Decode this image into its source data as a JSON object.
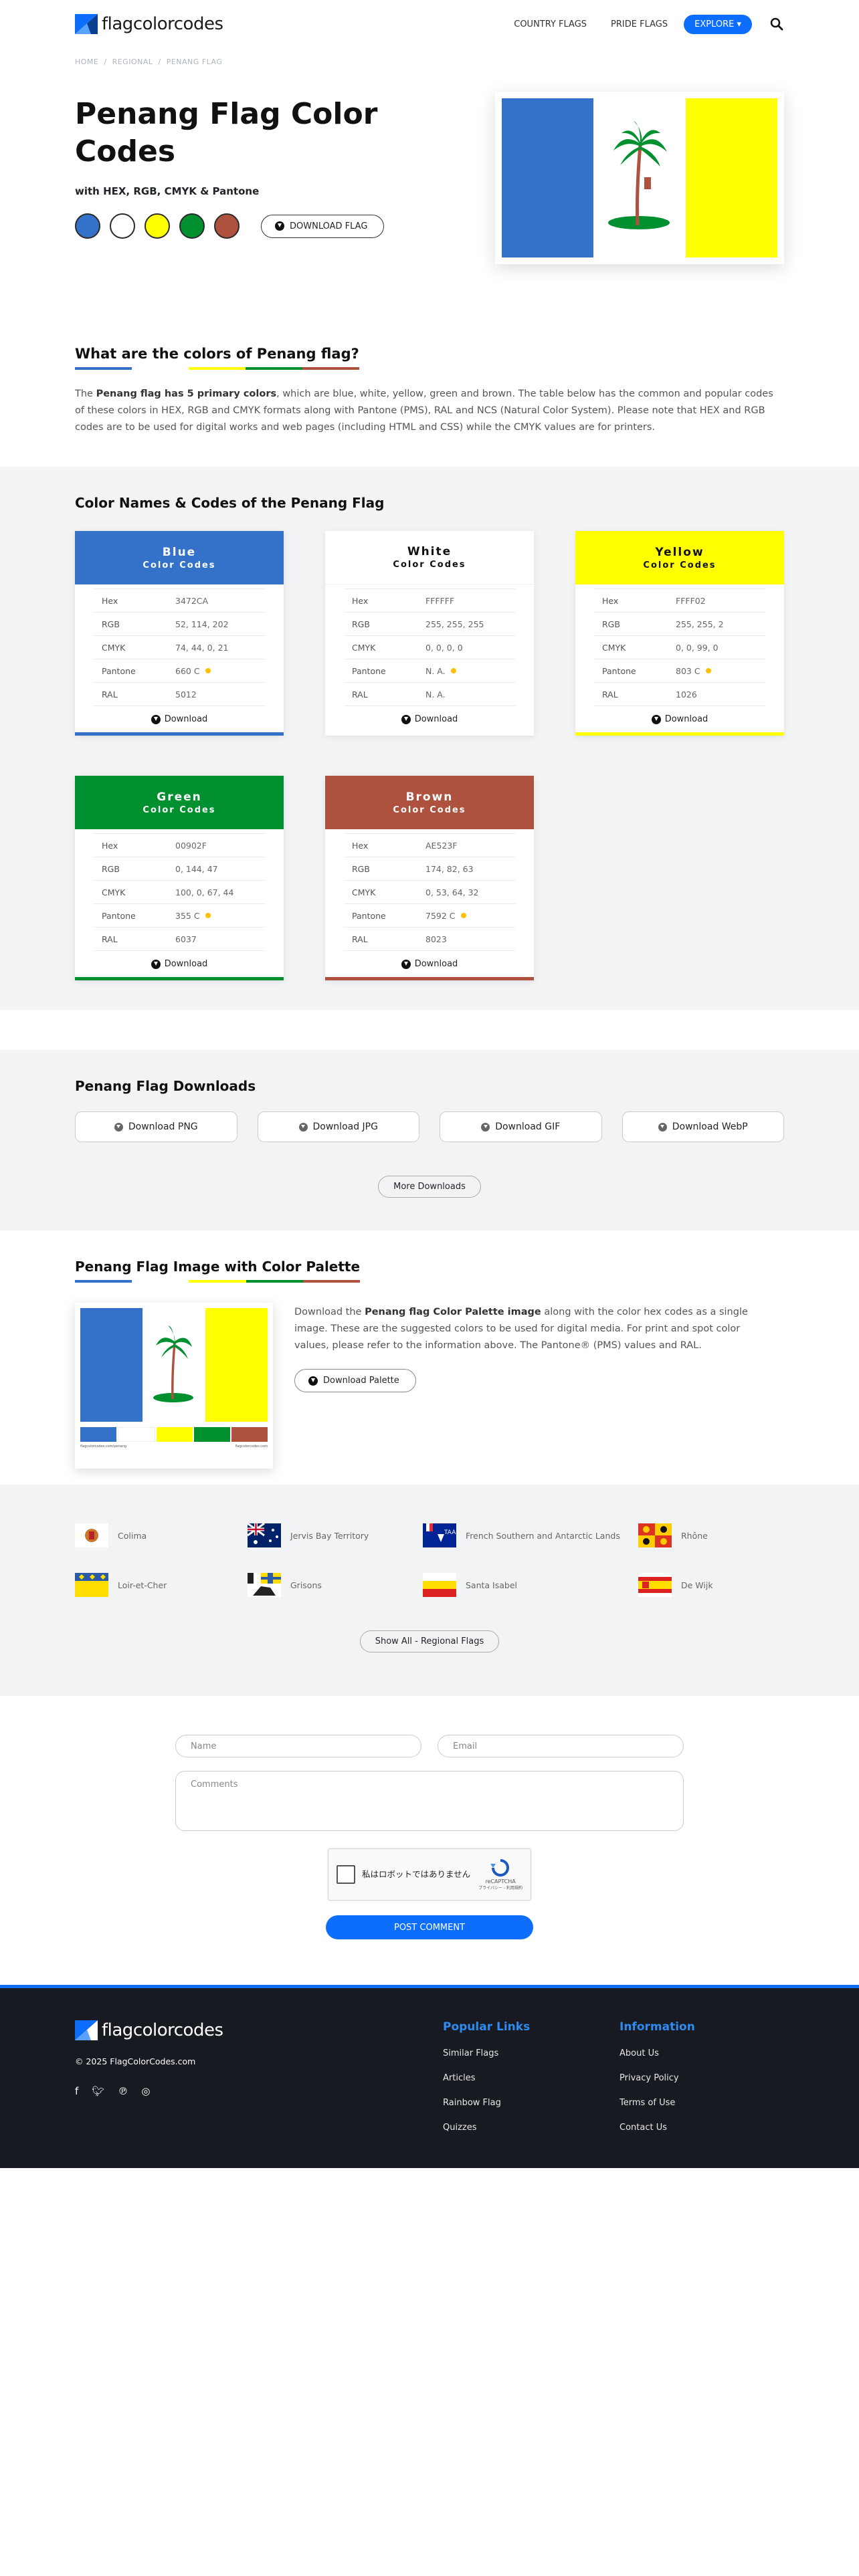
{
  "header": {
    "logo": "flagcolorcodes",
    "nav": [
      "COUNTRY FLAGS",
      "PRIDE FLAGS"
    ],
    "explore": "EXPLORE"
  },
  "breadcrumb": [
    "HOME",
    "REGIONAL",
    "PENANG FLAG"
  ],
  "hero": {
    "title_line1": "Penang Flag Color",
    "title_line2": "Codes",
    "subtitle": "with HEX, RGB, CMYK & Pantone",
    "download": "DOWNLOAD FLAG",
    "swatches": [
      "#3472CA",
      "#FFFFFF",
      "#FFFF02",
      "#00902F",
      "#AE523F"
    ]
  },
  "colors_section": {
    "title": "What are the colors of Penang flag?",
    "para_lead": "The ",
    "para_bold": "Penang flag has 5 primary colors",
    "para_rest": ", which are blue, white, yellow, green and brown. The table below has the common and popular codes of these colors in HEX, RGB and CMYK formats along with Pantone (PMS), RAL and NCS (Natural Color System). Please note that HEX and RGB codes are to be used for digital works and web pages (including HTML and CSS) while the CMYK values are for printers."
  },
  "codes_section": {
    "title": "Color Names & Codes of the Penang Flag",
    "sub": "Color Codes",
    "labels": [
      "Hex",
      "RGB",
      "CMYK",
      "Pantone",
      "RAL"
    ],
    "download": "Download",
    "cards": [
      {
        "name": "Blue",
        "bg": "#3472CA",
        "fg": "#ffffff",
        "hex": "3472CA",
        "rgb": "52, 114, 202",
        "cmyk": "74, 44, 0, 21",
        "pantone": "660 C",
        "ral": "5012"
      },
      {
        "name": "White",
        "bg": "#FFFFFF",
        "fg": "#111111",
        "hex": "FFFFFF",
        "rgb": "255, 255, 255",
        "cmyk": "0, 0, 0, 0",
        "pantone": "N. A.",
        "ral": "N. A."
      },
      {
        "name": "Yellow",
        "bg": "#FFFF02",
        "fg": "#111111",
        "hex": "FFFF02",
        "rgb": "255, 255, 2",
        "cmyk": "0, 0, 99, 0",
        "pantone": "803 C",
        "ral": "1026"
      },
      {
        "name": "Green",
        "bg": "#00902F",
        "fg": "#ffffff",
        "hex": "00902F",
        "rgb": "0, 144, 47",
        "cmyk": "100, 0, 67, 44",
        "pantone": "355 C",
        "ral": "6037"
      },
      {
        "name": "Brown",
        "bg": "#AE523F",
        "fg": "#ffffff",
        "hex": "AE523F",
        "rgb": "174, 82, 63",
        "cmyk": "0, 53, 64, 32",
        "pantone": "7592 C",
        "ral": "8023"
      }
    ]
  },
  "downloads": {
    "title": "Penang Flag Downloads",
    "buttons": [
      "Download PNG",
      "Download JPG",
      "Download GIF",
      "Download WebP"
    ],
    "more": "More Downloads"
  },
  "palette": {
    "title": "Penang Flag Image with Color Palette",
    "text_lead": "Download the ",
    "text_bold": "Penang flag Color Palette image",
    "text_rest": " along with the color hex codes as a single image. These are the suggested colors to be used for digital media. For print and spot color values, please refer to the information above. The Pantone® (PMS) values and RAL.",
    "button": "Download Palette",
    "img_left": "flagcolorcodes.com/penang",
    "img_right": "flagcolorcodes.com"
  },
  "related": {
    "items": [
      "Colima",
      "Jervis Bay Territory",
      "French Southern and Antarctic Lands",
      "Rhône",
      "Loir-et-Cher",
      "Grisons",
      "Santa Isabel",
      "De Wijk"
    ],
    "show_all": "Show All - Regional Flags"
  },
  "form": {
    "name_ph": "Name",
    "email_ph": "Email",
    "comments_ph": "Comments",
    "captcha_text": "私はロボットではありません",
    "captcha_brand": "reCAPTCHA",
    "captcha_links": "プライバシー - 利用規約",
    "post": "POST COMMENT"
  },
  "footer": {
    "logo": "flagcolorcodes",
    "copyright": "© 2025 FlagColorCodes.com",
    "popular_title": "Popular Links",
    "popular": [
      "Similar Flags",
      "Articles",
      "Rainbow Flag",
      "Quizzes"
    ],
    "info_title": "Information",
    "info": [
      "About Us",
      "Privacy Policy",
      "Terms of Use",
      "Contact Us"
    ]
  }
}
